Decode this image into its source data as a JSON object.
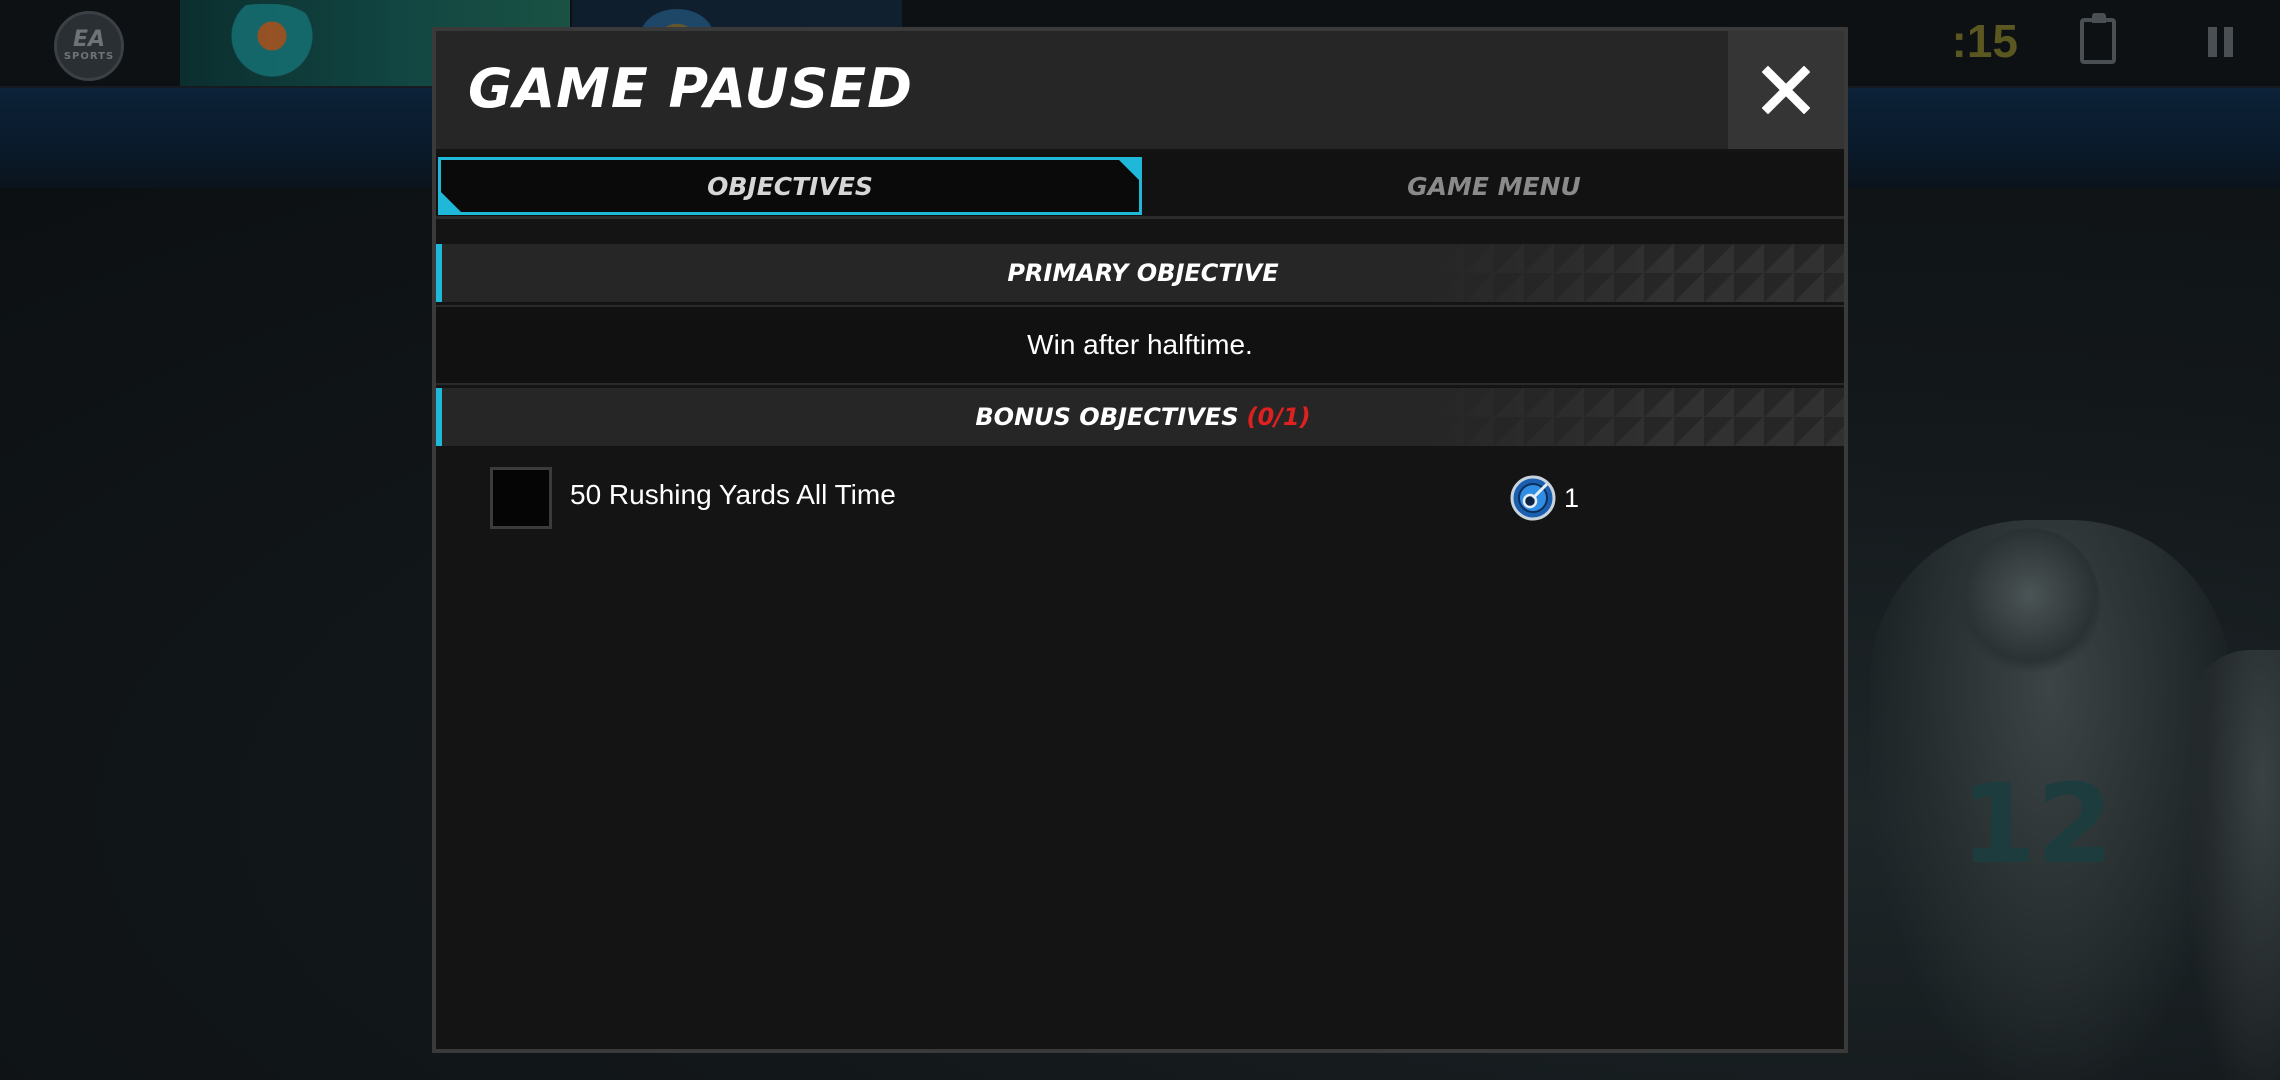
{
  "hud": {
    "ea_logo_top": "EA",
    "ea_logo_bottom": "SPORTS",
    "clock": ":15",
    "jersey_number": "12"
  },
  "modal": {
    "title": "GAME PAUSED",
    "tabs": [
      {
        "label": "OBJECTIVES",
        "active": true
      },
      {
        "label": "GAME MENU",
        "active": false
      }
    ],
    "primary": {
      "header": "PRIMARY OBJECTIVE",
      "text": "Win after halftime."
    },
    "bonus": {
      "header": "BONUS OBJECTIVES",
      "count": "(0/1)",
      "items": [
        {
          "text": "50 Rushing Yards All Time",
          "checked": false,
          "reward_icon": "token-icon",
          "reward_count": "1"
        }
      ]
    }
  },
  "colors": {
    "accent": "#1fb8d8",
    "count_red": "#e02020",
    "panel": "#141414",
    "header": "#262626"
  }
}
